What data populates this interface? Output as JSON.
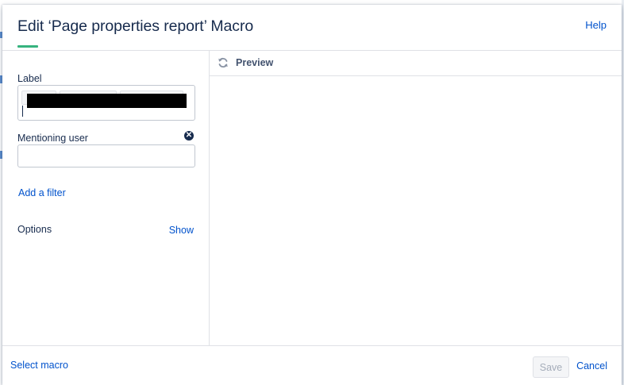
{
  "dialog": {
    "title": "Edit ‘Page properties report’ Macro",
    "help_label": "Help"
  },
  "form": {
    "label_field": {
      "label": "Label",
      "value": ""
    },
    "mentioning_user_field": {
      "label": "Mentioning user",
      "value": "",
      "placeholder": ""
    },
    "add_filter_label": "Add a filter",
    "options_label": "Options",
    "show_label": "Show"
  },
  "preview": {
    "title": "Preview"
  },
  "footer": {
    "select_macro_label": "Select macro",
    "save_label": "Save",
    "cancel_label": "Cancel"
  },
  "icons": {
    "refresh": "refresh-icon",
    "remove": "close-circle-icon"
  },
  "colors": {
    "accent": "#36b37e",
    "link": "#0052cc",
    "text": "#172b4d",
    "border": "#dfe1e6",
    "disabled_text": "#a5adba"
  }
}
